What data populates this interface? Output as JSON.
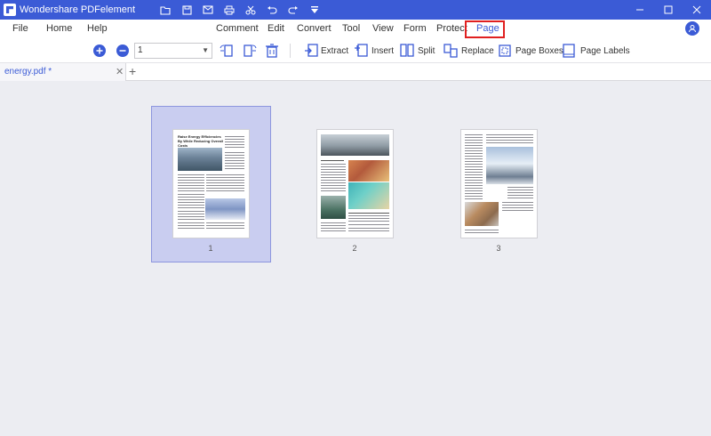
{
  "window": {
    "title": "Wondershare PDFelement"
  },
  "menu": {
    "file": "File",
    "home": "Home",
    "help": "Help",
    "comment": "Comment",
    "edit": "Edit",
    "convert": "Convert",
    "tool": "Tool",
    "view": "View",
    "form": "Form",
    "protect": "Protect",
    "page": "Page"
  },
  "toolbar": {
    "page_number": "1",
    "extract": "Extract",
    "insert": "Insert",
    "split": "Split",
    "replace": "Replace",
    "page_boxes": "Page Boxes",
    "page_labels": "Page Labels"
  },
  "tabs": {
    "document": "energy.pdf *"
  },
  "pages": {
    "p1": "1",
    "p2": "2",
    "p3": "3"
  },
  "page1": {
    "heading": "Raise Energy Efficiencies By While Reducing Overall Costs"
  },
  "colors": {
    "accent": "#3b5bd6",
    "highlight_box": "#e02020",
    "selected_thumb": "#c9cdf0"
  },
  "icons": {
    "quick_access": [
      "folder-icon",
      "save-icon",
      "mail-icon",
      "print-icon",
      "scissors-icon",
      "undo-icon",
      "redo-icon",
      "dropdown-icon"
    ]
  }
}
